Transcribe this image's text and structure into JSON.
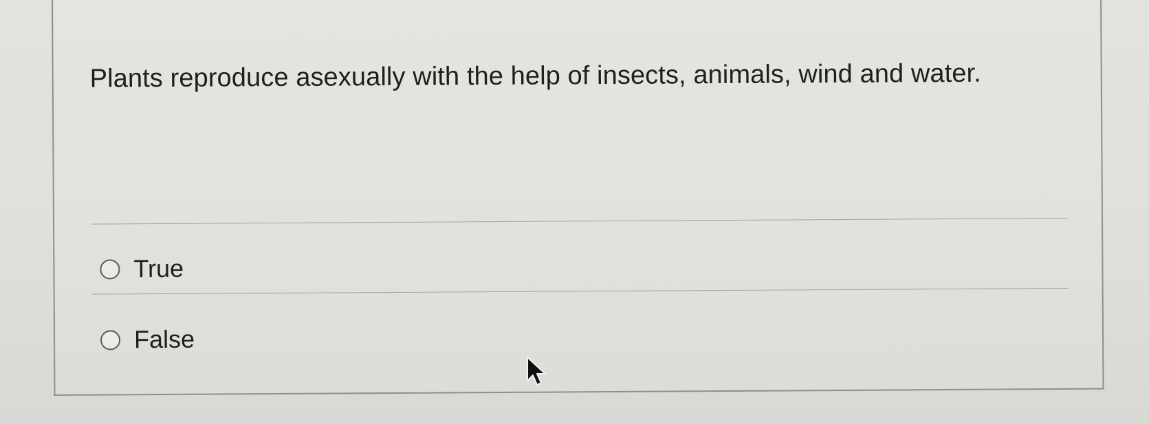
{
  "question": {
    "text": "Plants reproduce asexually with the help of insects, animals, wind and water."
  },
  "answers": [
    {
      "label": "True",
      "selected": false
    },
    {
      "label": "False",
      "selected": false
    }
  ],
  "icons": {
    "cursor": "mouse-pointer-icon",
    "radio": "radio-button-icon"
  },
  "colors": {
    "text": "#1f1f1f",
    "border": "#8e8e8c",
    "background": "#e1e1dd"
  }
}
